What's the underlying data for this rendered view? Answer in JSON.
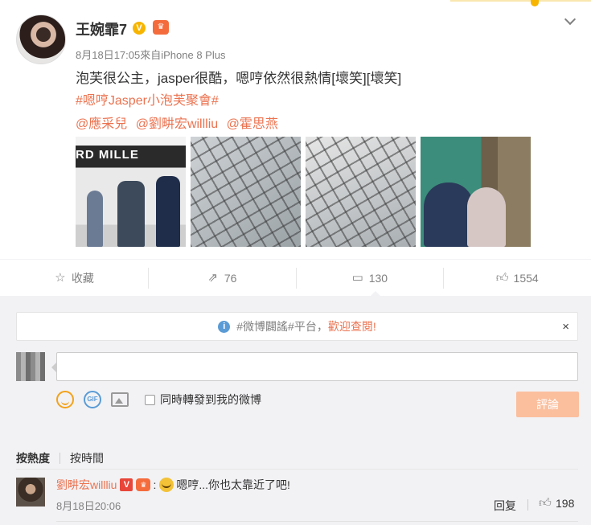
{
  "post": {
    "username": "王婉霏7",
    "verified_badge": "V",
    "member_badge": "VIP",
    "date": "8月18日17:05",
    "source": "來自iPhone 8 Plus",
    "content": "泡芙很公主，jasper很酷，嗯哼依然很熱情[壞笑][壞笑]",
    "topic": "#嗯哼Jasper小泡芙聚會#",
    "mentions": [
      "@應采兒",
      "@劉畊宏willliu",
      "@霍思燕"
    ],
    "photo1_sign": "RD MILLE",
    "icons": {
      "menu": "chevron-down-icon",
      "favorite": "star-icon",
      "repost": "share-icon",
      "comment": "comment-icon",
      "like": "thumbs-up-icon"
    }
  },
  "actions": {
    "favorite_label": "收藏",
    "repost_count": "76",
    "comment_count": "130",
    "like_count": "1554"
  },
  "notice": {
    "info_glyph": "i",
    "text": "#微博闢謠#平台，",
    "link": "歡迎查閱!",
    "close": "×"
  },
  "composer": {
    "placeholder": "",
    "gif_label": "GIF",
    "repost_checkbox_label": "同時轉發到我的微博",
    "submit_label": "評論"
  },
  "sort": {
    "by_hot": "按熱度",
    "by_time": "按時間"
  },
  "comment": {
    "user": "劉畊宏willliu",
    "verified_badge": "V",
    "member_badge": "VIP",
    "colon": ":",
    "text": "嗯哼...你也太靠近了吧!",
    "time": "8月18日20:06",
    "reply_label": "回复",
    "like_count": "198"
  },
  "colors": {
    "accent": "#eb7350",
    "link_orange": "#eb7350",
    "submit_disabled": "#fbbf9e",
    "panel_bg": "#f2f2f5"
  }
}
